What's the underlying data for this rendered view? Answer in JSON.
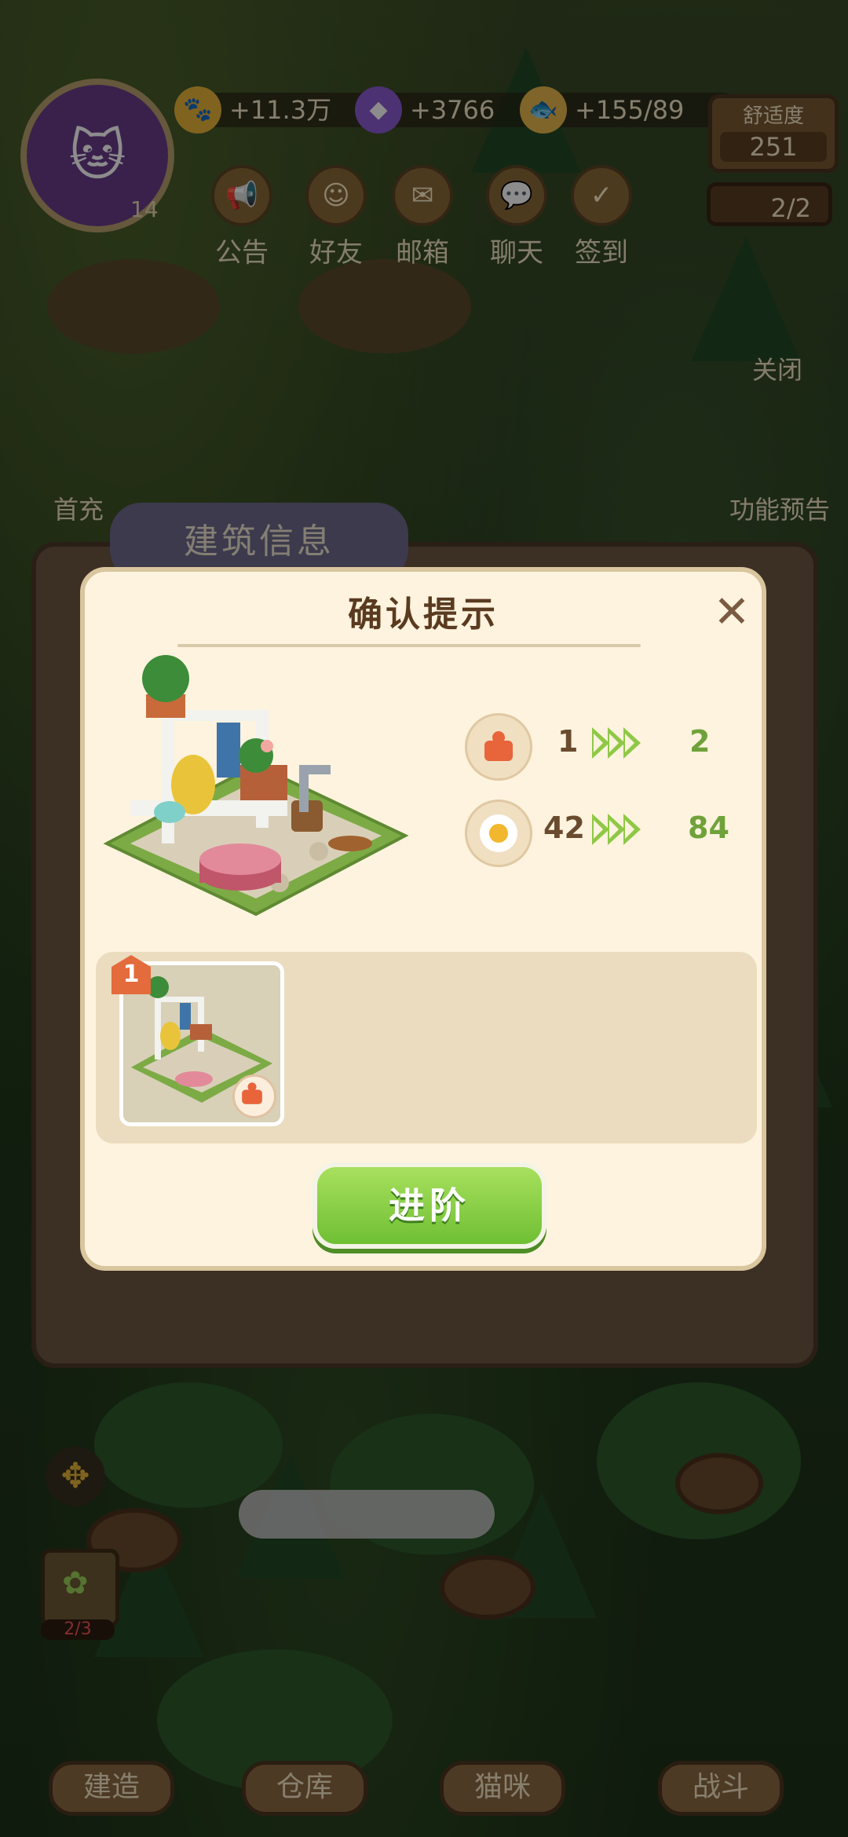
{
  "hud": {
    "gold": "+11.3万",
    "gems": "+3766",
    "fish": "+155/89",
    "level": "14",
    "comfort_label": "舒适度",
    "comfort_value": "251",
    "cats_count": "2/2"
  },
  "top_menu": [
    {
      "label": "公告",
      "icon": "announcement-icon"
    },
    {
      "label": "好友",
      "icon": "friends-icon"
    },
    {
      "label": "邮箱",
      "icon": "mail-icon"
    },
    {
      "label": "聊天",
      "icon": "chat-icon"
    },
    {
      "label": "签到",
      "icon": "checkin-icon"
    }
  ],
  "side": {
    "close_label": "关闭",
    "preview_label": "功能预告",
    "first_charge_label": "首充"
  },
  "background_panel": {
    "title": "建筑信息"
  },
  "modal": {
    "title": "确认提示",
    "stats": [
      {
        "icon": "level-icon",
        "from": "1",
        "to": "2"
      },
      {
        "icon": "egg-icon",
        "from": "42",
        "to": "84"
      }
    ],
    "slot_number": "1",
    "advance_label": "进阶"
  },
  "storage": {
    "counter": "2/3"
  },
  "bottom_nav": [
    {
      "label": "建造"
    },
    {
      "label": "仓库"
    },
    {
      "label": "猫咪"
    },
    {
      "label": "战斗"
    }
  ],
  "colors": {
    "modal_bg": "#fdf3de",
    "advance_green": "#8fc846",
    "stat_to_green": "#6fa23a",
    "title_brown": "#5a3b20"
  }
}
